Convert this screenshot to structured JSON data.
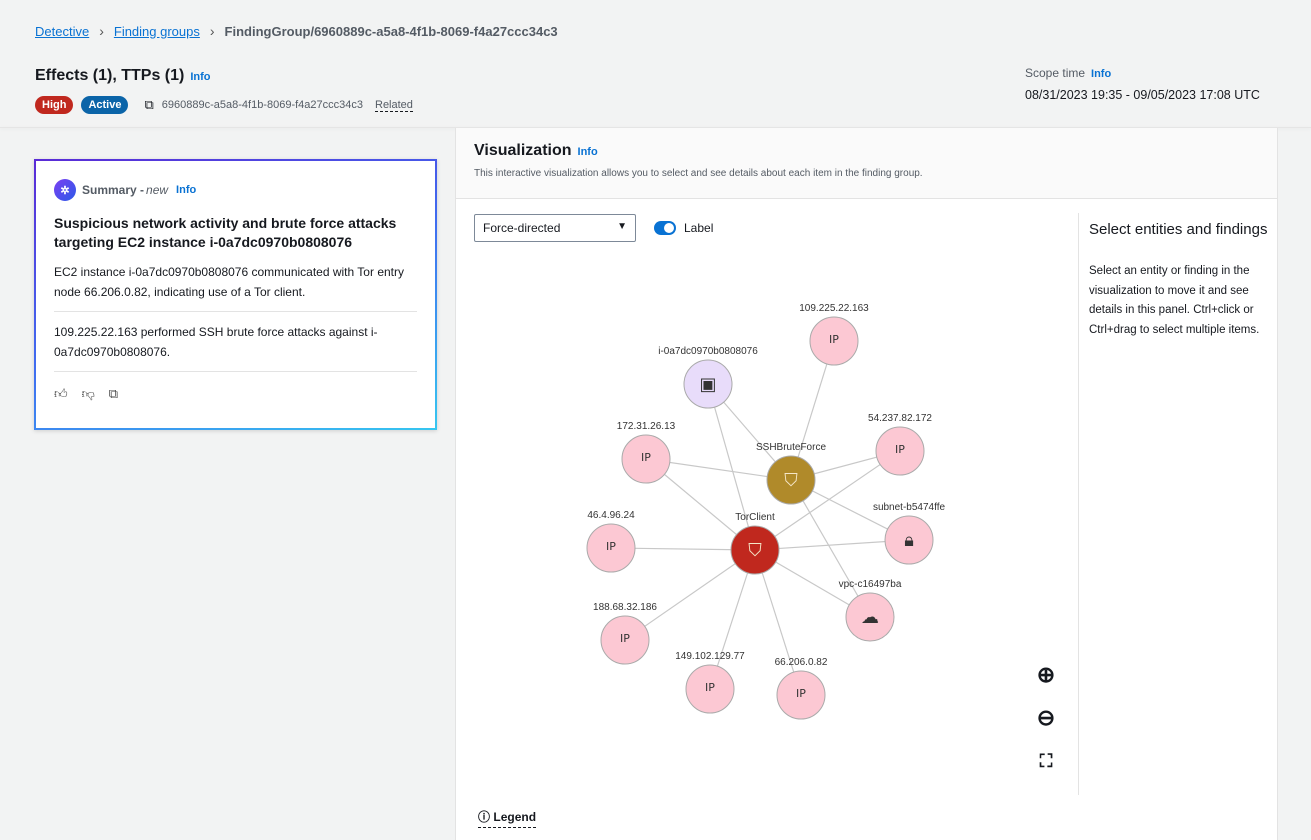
{
  "breadcrumb": {
    "items": [
      "Detective",
      "Finding groups"
    ],
    "current": "FindingGroup/6960889c-a5a8-4f1b-8069-f4a27ccc34c3"
  },
  "header": {
    "title": "Effects (1), TTPs (1)",
    "info": "Info",
    "severity": "High",
    "status": "Active",
    "id": "6960889c-a5a8-4f1b-8069-f4a27ccc34c3",
    "related": "Related",
    "scope_label": "Scope time",
    "scope_info": "Info",
    "scope_value": "08/31/2023 19:35 - 09/05/2023 17:08 UTC"
  },
  "colors": {
    "high": "#c0281e",
    "active": "#0b64a8",
    "accent": "#0972d3"
  },
  "summary": {
    "label": "Summary - ",
    "new": "new",
    "info": "Info",
    "title": "Suspicious network activity and brute force attacks targeting EC2 instance i-0a7dc0970b0808076",
    "p1": "EC2 instance i-0a7dc0970b0808076 communicated with Tor entry node 66.206.0.82, indicating use of a Tor client.",
    "p2": "109.225.22.163 performed SSH brute force attacks against i-0a7dc0970b0808076."
  },
  "viz": {
    "title": "Visualization",
    "info": "Info",
    "description": "This interactive visualization allows you to select and see details about each item in the finding group.",
    "layout": "Force-directed",
    "label_toggle": "Label",
    "label_on": true,
    "legend": "Legend",
    "side_title": "Select entities and findings",
    "side_text": "Select an entity or finding in the visualization to move it and see details in this panel. Ctrl+click or Ctrl+drag to select multiple items."
  },
  "graph": {
    "nodes": [
      {
        "label": "i-0a7dc0970b0808076",
        "type": "instance"
      },
      {
        "label": "109.225.22.163",
        "type": "ip"
      },
      {
        "label": "172.31.26.13",
        "type": "ip"
      },
      {
        "label": "SSHBruteForce",
        "type": "finding-ssh"
      },
      {
        "label": "54.237.82.172",
        "type": "ip"
      },
      {
        "label": "46.4.96.24",
        "type": "ip"
      },
      {
        "label": "TorClient",
        "type": "finding-tor"
      },
      {
        "label": "subnet-b5474ffe",
        "type": "subnet"
      },
      {
        "label": "188.68.32.186",
        "type": "ip"
      },
      {
        "label": "vpc-c16497ba",
        "type": "vpc"
      },
      {
        "label": "149.102.129.77",
        "type": "ip"
      },
      {
        "label": "66.206.0.82",
        "type": "ip"
      }
    ],
    "edges": [
      [
        "i-0a7dc0970b0808076",
        "SSHBruteForce"
      ],
      [
        "i-0a7dc0970b0808076",
        "TorClient"
      ],
      [
        "109.225.22.163",
        "SSHBruteForce"
      ],
      [
        "54.237.82.172",
        "SSHBruteForce"
      ],
      [
        "54.237.82.172",
        "TorClient"
      ],
      [
        "172.31.26.13",
        "SSHBruteForce"
      ],
      [
        "172.31.26.13",
        "TorClient"
      ],
      [
        "SSHBruteForce",
        "subnet-b5474ffe"
      ],
      [
        "SSHBruteForce",
        "vpc-c16497ba"
      ],
      [
        "TorClient",
        "subnet-b5474ffe"
      ],
      [
        "46.4.96.24",
        "TorClient"
      ],
      [
        "TorClient",
        "vpc-c16497ba"
      ],
      [
        "TorClient",
        "188.68.32.186"
      ],
      [
        "TorClient",
        "149.102.129.77"
      ],
      [
        "TorClient",
        "66.206.0.82"
      ]
    ]
  }
}
